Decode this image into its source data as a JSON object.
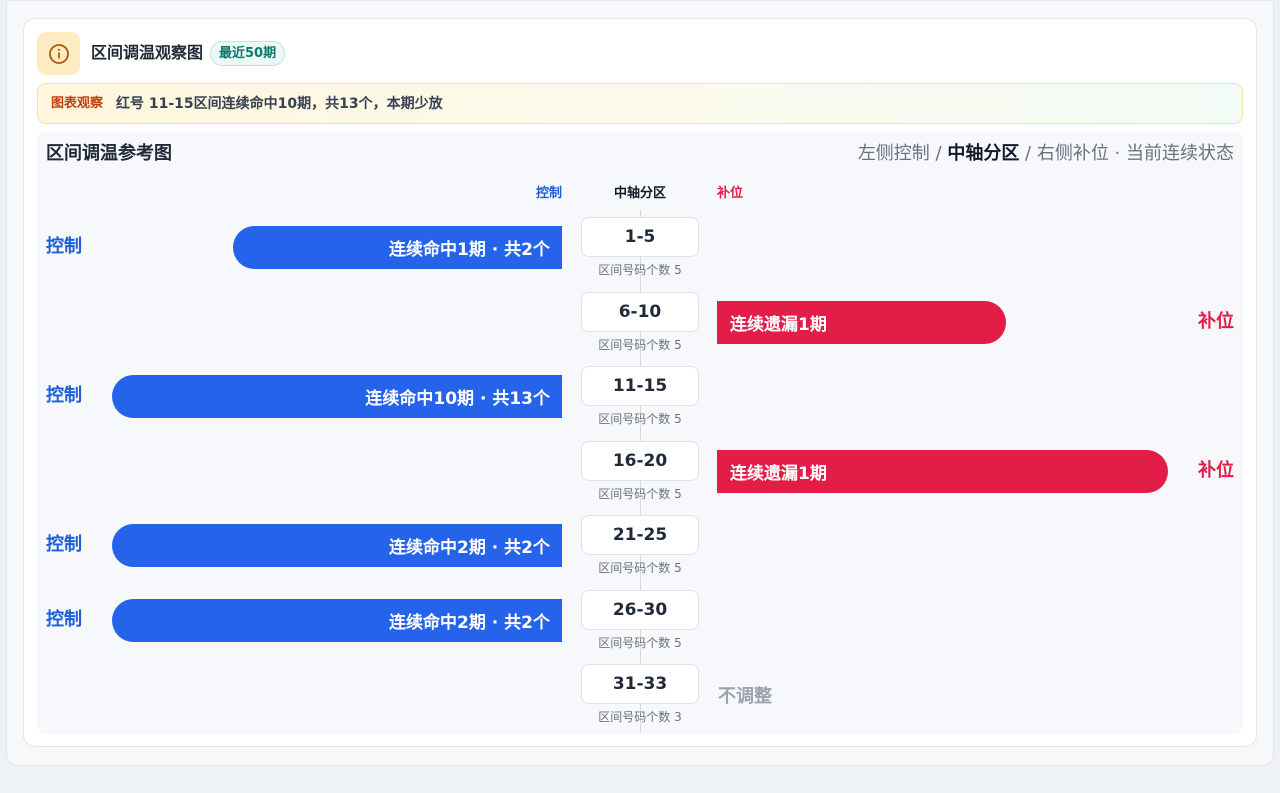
{
  "header": {
    "icon": "info-icon",
    "title": "区间调温观察图",
    "badge": "最近50期"
  },
  "notice": {
    "tag": "图表观察",
    "text": "红号 11-15区间连续命中10期，共13个，本期少放"
  },
  "panel": {
    "title": "区间调温参考图",
    "legend": {
      "left": "左侧控制 / ",
      "mid": "中轴分区",
      "right": " / 右侧补位 · 当前连续状态"
    },
    "columns": {
      "left": "控制",
      "mid": "中轴分区",
      "right": "补位"
    }
  },
  "zones": [
    {
      "range": "1-5",
      "count_text": "区间号码个数 5",
      "side": "control",
      "label": "控制",
      "bar_text": "连续命中1期 · 共2个",
      "bar_fraction": 0.73
    },
    {
      "range": "6-10",
      "count_text": "区间号码个数 5",
      "side": "fill",
      "label": "补位",
      "bar_text": "连续遗漏1期",
      "bar_fraction": 0.64
    },
    {
      "range": "11-15",
      "count_text": "区间号码个数 5",
      "side": "control",
      "label": "控制",
      "bar_text": "连续命中10期 · 共13个",
      "bar_fraction": 1.0
    },
    {
      "range": "16-20",
      "count_text": "区间号码个数 5",
      "side": "fill",
      "label": "补位",
      "bar_text": "连续遗漏1期",
      "bar_fraction": 1.0
    },
    {
      "range": "21-25",
      "count_text": "区间号码个数 5",
      "side": "control",
      "label": "控制",
      "bar_text": "连续命中2期 · 共2个",
      "bar_fraction": 1.0
    },
    {
      "range": "26-30",
      "count_text": "区间号码个数 5",
      "side": "control",
      "label": "控制",
      "bar_text": "连续命中2期 · 共2个",
      "bar_fraction": 1.0
    },
    {
      "range": "31-33",
      "count_text": "区间号码个数 3",
      "side": "none",
      "label": "不调整",
      "bar_text": "",
      "bar_fraction": 0
    }
  ],
  "colors": {
    "control": "#2563eb",
    "fill": "#e11d48",
    "neutral": "#9ca3af",
    "badge": "#0f766e"
  }
}
